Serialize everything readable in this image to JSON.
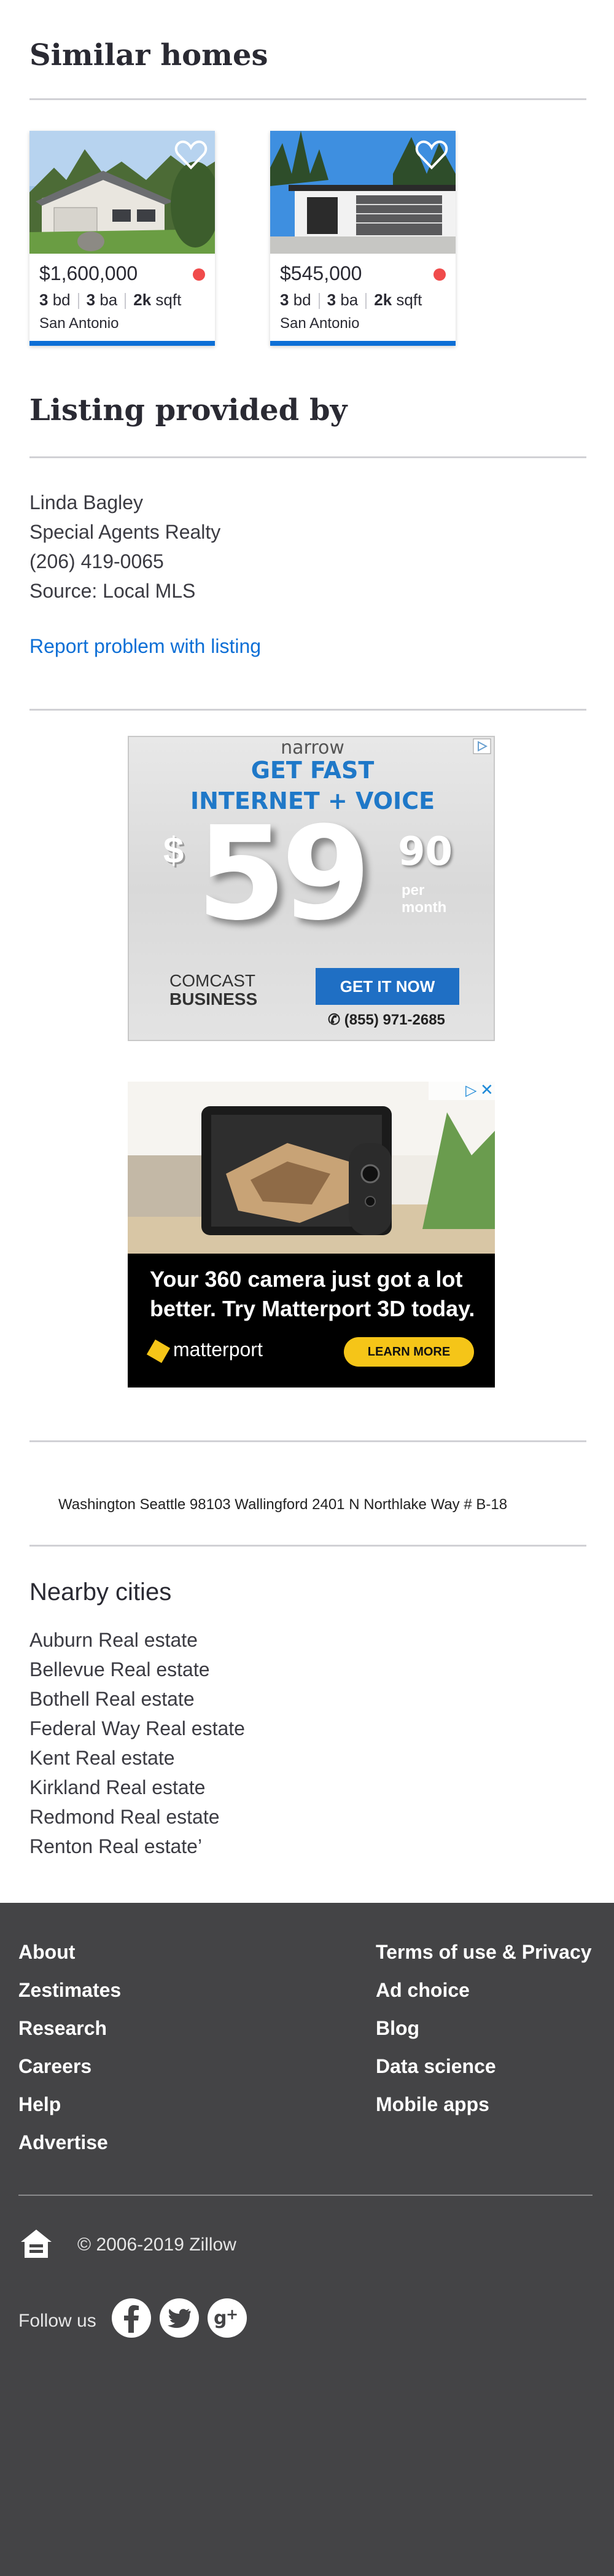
{
  "similar": {
    "title": "Similar homes",
    "cards": [
      {
        "price": "$1,600,000",
        "beds": "3",
        "beds_unit": "bd",
        "baths": "3",
        "baths_unit": "ba",
        "sqft": "2k",
        "sqft_unit": "sqft",
        "city": "San Antonio"
      },
      {
        "price": "$545,000",
        "beds": "3",
        "beds_unit": "bd",
        "baths": "3",
        "baths_unit": "ba",
        "sqft": "2k",
        "sqft_unit": "sqft",
        "city": "San Antonio"
      }
    ]
  },
  "listing": {
    "title": "Listing provided by",
    "agent": "Linda Bagley",
    "office": "Special Agents Realty",
    "phone": "(206) 419-0065",
    "source": "Source: Local MLS",
    "report": "Report problem with listing"
  },
  "ad_comcast": {
    "brand_top": "narrow",
    "headline1": "GET FAST",
    "headline2": "INTERNET + VOICE",
    "dollar": "$",
    "big": "59",
    "cents": "90",
    "per": "per",
    "month": "month",
    "brand1": "COMCAST",
    "brand2": "BUSINESS",
    "cta": "GET IT NOW",
    "phone": "(855) 971-2685"
  },
  "ad_matterport": {
    "line1": "Your 360 camera just got a lot",
    "line2": "better. Try Matterport 3D today.",
    "brand": "matterport",
    "cta": "LEARN MORE"
  },
  "address": "Washington Seattle 98103 Wallingford 2401 N Northlake Way # B-18",
  "nearby": {
    "title": "Nearby cities",
    "items": [
      "Auburn Real estate",
      "Bellevue Real estate",
      "Bothell Real estate",
      "Federal Way Real estate",
      "Kent Real estate",
      "Kirkland Real estate",
      "Redmond Real estate",
      "Renton Real estate’"
    ]
  },
  "footer": {
    "left": [
      "About",
      "Zestimates",
      "Research",
      "Careers",
      "Help",
      "Advertise"
    ],
    "right": [
      "Terms of use & Privacy",
      "Ad choice",
      "Blog",
      "Data science",
      "Mobile apps"
    ],
    "copyright": "© 2006-2019 Zillow",
    "follow": "Follow us"
  },
  "colors": {
    "accent": "#0d6fd6",
    "footer_bg": "#444446",
    "status_dot": "#f04b4b"
  }
}
